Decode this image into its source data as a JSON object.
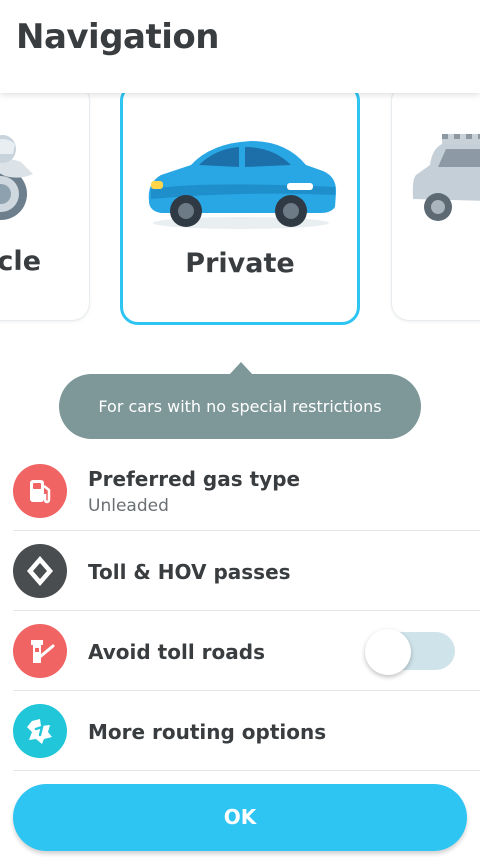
{
  "header": {
    "title": "Navigation"
  },
  "vehicles": {
    "left": {
      "label": "ycle",
      "icon": "motorcycle-icon"
    },
    "center": {
      "label": "Private",
      "icon": "car-icon",
      "selected": true
    },
    "right": {
      "label": "",
      "icon": "taxi-icon"
    }
  },
  "tooltip": {
    "text": "For cars with no special restrictions"
  },
  "options": [
    {
      "title": "Preferred gas type",
      "subtitle": "Unleaded",
      "icon": "gas-pump-icon",
      "color": "#f16464"
    },
    {
      "title": "Toll & HOV passes",
      "icon": "diamond-lane-icon",
      "color": "#4a4d4f"
    },
    {
      "title": "Avoid toll roads",
      "icon": "toll-booth-icon",
      "color": "#f16464",
      "toggle_on": false
    },
    {
      "title": "More routing options",
      "icon": "routing-icon",
      "color": "#21c6d9"
    }
  ],
  "ok_label": "OK",
  "colors": {
    "accent": "#2ec5f3",
    "tooltip": "#7e9799"
  }
}
